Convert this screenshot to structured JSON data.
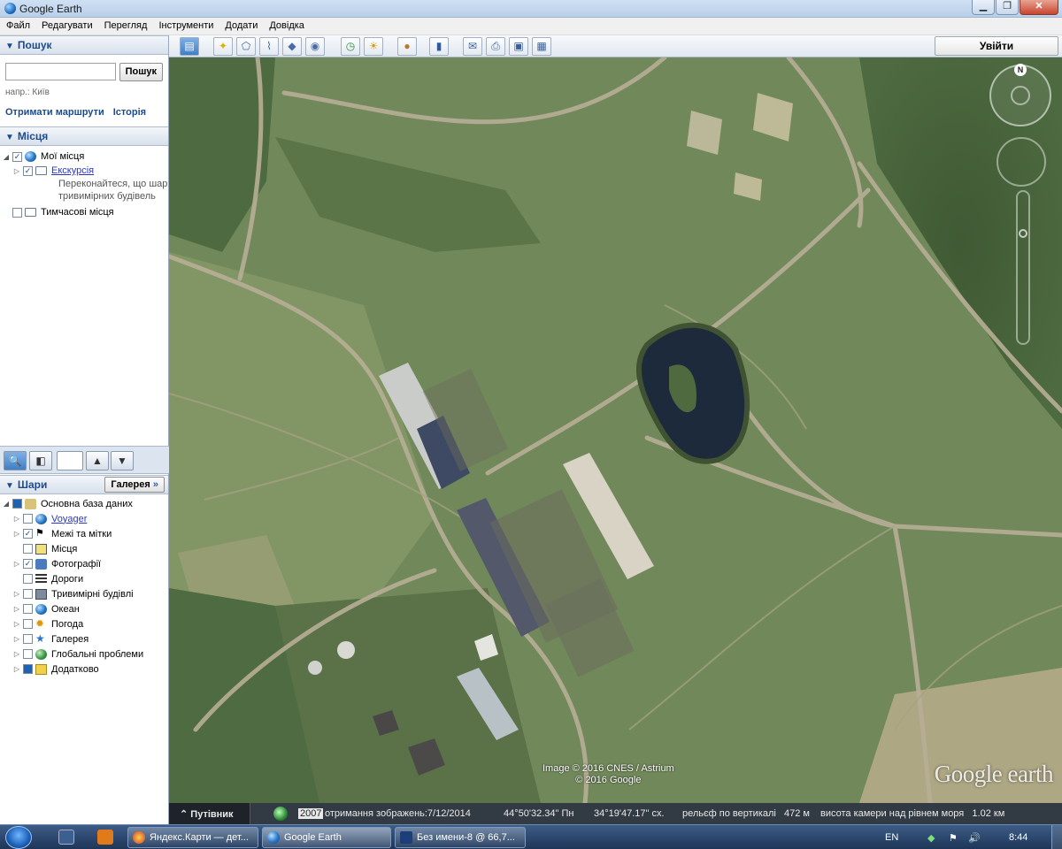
{
  "window": {
    "title": "Google Earth"
  },
  "menu": [
    "Файл",
    "Редагувати",
    "Перегляд",
    "Інструменти",
    "Додати",
    "Довідка"
  ],
  "search": {
    "header": "Пошук",
    "button": "Пошук",
    "example": "напр.: Київ",
    "route_link": "Отримати маршрути",
    "history_link": "Історія"
  },
  "places": {
    "header": "Місця",
    "items": [
      {
        "label": "Мої місця"
      },
      {
        "label": "Екскурсія"
      },
      {
        "label": "Тимчасові місця"
      }
    ],
    "description": [
      "Переконайтеся, що шар",
      "тривимірних будівель"
    ]
  },
  "layers": {
    "header": "Шари",
    "gallery_button": "Галерея",
    "items": [
      {
        "label": "Основна база даних"
      },
      {
        "label": "Voyager"
      },
      {
        "label": "Межі та мітки"
      },
      {
        "label": "Місця"
      },
      {
        "label": "Фотографії"
      },
      {
        "label": "Дороги"
      },
      {
        "label": "Тривимірні будівлі"
      },
      {
        "label": "Океан"
      },
      {
        "label": "Погода"
      },
      {
        "label": "Галерея"
      },
      {
        "label": "Глобальні проблеми"
      },
      {
        "label": "Додатково"
      }
    ]
  },
  "toolbar": {
    "login": "Увійти"
  },
  "map": {
    "compass_north": "N",
    "credit_line1": "Image © 2016 CNES / Astrium",
    "credit_line2": "© 2016 Google",
    "logo": "Google earth"
  },
  "status": {
    "guide": "Путівник",
    "year": "2007",
    "imagery_date": "отримання зображень:7/12/2014",
    "lat": "44°50'32.34\" Пн",
    "lon": "34°19'47.17\" сх.",
    "elevation": "рельєф по вертикалі   472 м",
    "eye_alt": "висота камери над рівнем моря   1.02 км"
  },
  "taskbar": {
    "tasks": [
      {
        "label": "Яндекс.Карти — дет..."
      },
      {
        "label": "Google Earth"
      },
      {
        "label": "Без имени-8 @ 66,7..."
      }
    ],
    "lang": "EN",
    "time": "8:44"
  },
  "colors": {
    "accent": "#1d4a8a",
    "link": "#2a37c5",
    "map_grass": "#6d8456",
    "water": "#1d2a3c"
  }
}
